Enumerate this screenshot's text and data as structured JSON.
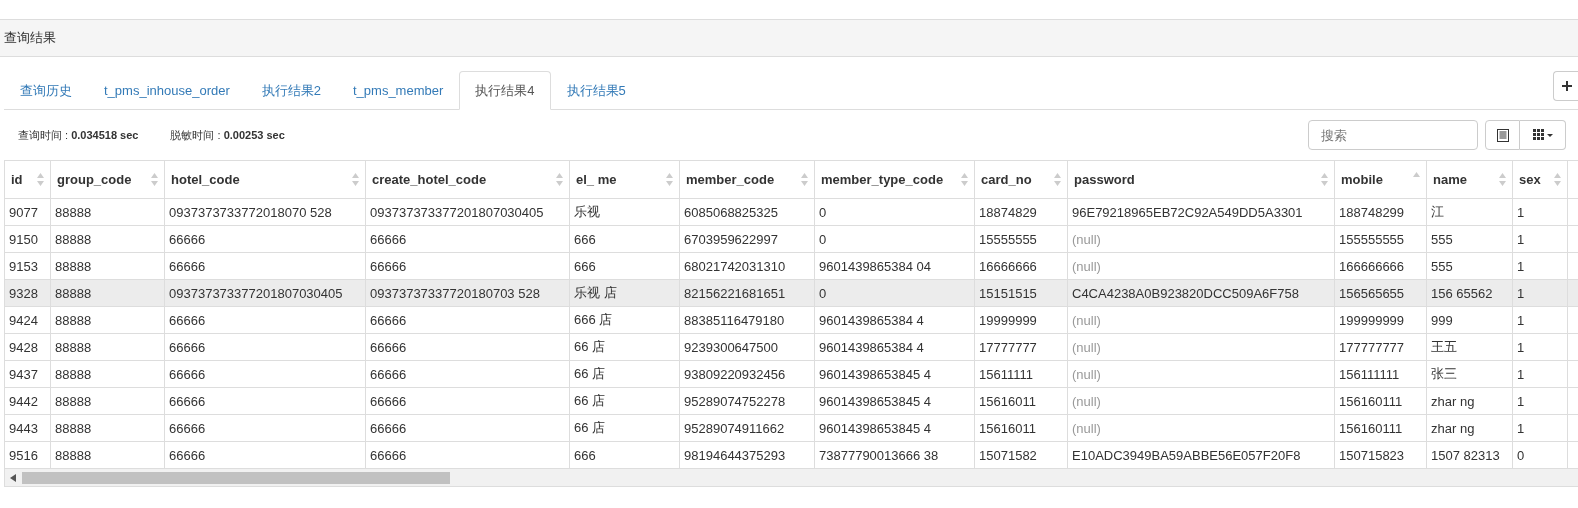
{
  "panel": {
    "title": "查询结果"
  },
  "tabs": [
    {
      "label": "查询历史",
      "selected": false
    },
    {
      "label": "t_pms_inhouse_order",
      "selected": false
    },
    {
      "label": "执行结果2",
      "selected": false
    },
    {
      "label": "t_pms_member",
      "selected": false
    },
    {
      "label": "执行结果4",
      "selected": true
    },
    {
      "label": "执行结果5",
      "selected": false
    }
  ],
  "stats": [
    {
      "label": "查询时间 : ",
      "value": "0.034518 sec"
    },
    {
      "label": "脱敏时间 : ",
      "value": "0.00253 sec"
    }
  ],
  "search": {
    "placeholder": "搜索"
  },
  "table": {
    "columns": [
      {
        "label": "id",
        "sort_up": true,
        "sort_down": true
      },
      {
        "label": "group_code",
        "sort_up": true,
        "sort_down": true
      },
      {
        "label": "hotel_code",
        "sort_up": true,
        "sort_down": true
      },
      {
        "label": "create_hotel_code",
        "sort_up": true,
        "sort_down": true
      },
      {
        "label": "el_ me",
        "sort_up": true,
        "sort_down": true
      },
      {
        "label": "member_code",
        "sort_up": true,
        "sort_down": true
      },
      {
        "label": "member_type_code",
        "sort_up": true,
        "sort_down": true
      },
      {
        "label": "card_no",
        "sort_up": true,
        "sort_down": true
      },
      {
        "label": "password",
        "sort_up": true,
        "sort_down": true
      },
      {
        "label": "mobile",
        "sort_up": true,
        "sort_down": false
      },
      {
        "label": "name",
        "sort_up": true,
        "sort_down": true
      },
      {
        "label": "sex",
        "sort_up": true,
        "sort_down": true
      }
    ],
    "rows": [
      {
        "highlighted": false,
        "cells": [
          "9077",
          "88888",
          "0937373733772018070 528",
          "093737373377201807030405",
          "乐视",
          "6085068825325",
          "0",
          "18874829",
          "96E79218965EB72C92A549DD5A3301",
          "188748299",
          "江",
          "1"
        ]
      },
      {
        "highlighted": false,
        "cells": [
          "9150",
          "88888",
          "66666",
          "66666",
          "666",
          "6703959622997",
          "0",
          "15555555",
          {
            "text": "(null)",
            "kind": "null"
          },
          "155555555",
          "555",
          "1"
        ]
      },
      {
        "highlighted": false,
        "cells": [
          "9153",
          "88888",
          "66666",
          "66666",
          "666",
          "68021742031310",
          "9601439865384 04",
          "16666666",
          {
            "text": "(null)",
            "kind": "null"
          },
          "166666666",
          "555",
          "1"
        ]
      },
      {
        "highlighted": true,
        "cells": [
          "9328",
          "88888",
          "093737373377201807030405",
          "09373737337720180703 528",
          "乐视 店",
          "82156221681651",
          "0",
          "15151515",
          "C4CA4238A0B923820DCC509A6F758",
          "156565655",
          "156 65562",
          "1"
        ]
      },
      {
        "highlighted": false,
        "cells": [
          "9424",
          "88888",
          "66666",
          "66666",
          "666 店",
          "88385116479180",
          "9601439865384 4",
          "19999999",
          {
            "text": "(null)",
            "kind": "null"
          },
          "199999999",
          "999",
          "1"
        ]
      },
      {
        "highlighted": false,
        "cells": [
          "9428",
          "88888",
          "66666",
          "66666",
          "66 店",
          "9239300647500",
          "9601439865384 4",
          "17777777",
          {
            "text": "(null)",
            "kind": "null"
          },
          "177777777",
          "王五",
          "1"
        ]
      },
      {
        "highlighted": false,
        "cells": [
          "9437",
          "88888",
          "66666",
          "66666",
          "66 店",
          "93809220932456",
          "96014398653845 4",
          "15611111",
          {
            "text": "(null)",
            "kind": "null"
          },
          "156111111",
          "张三",
          "1"
        ]
      },
      {
        "highlighted": false,
        "cells": [
          "9442",
          "88888",
          "66666",
          "66666",
          "66 店",
          "95289074752278",
          "96014398653845 4",
          "15616011",
          {
            "text": "(null)",
            "kind": "null"
          },
          "156160111",
          "zhar ng",
          "1"
        ]
      },
      {
        "highlighted": false,
        "cells": [
          "9443",
          "88888",
          "66666",
          "66666",
          "66 店",
          "95289074911662",
          "96014398653845 4",
          "15616011",
          {
            "text": "(null)",
            "kind": "null"
          },
          "156160111",
          "zhar ng",
          "1"
        ]
      },
      {
        "highlighted": false,
        "cells": [
          "9516",
          "88888",
          "66666",
          "66666",
          "666",
          "98194644375293",
          "73877790013666 38",
          "15071582",
          "E10ADC3949BA59ABBE56E057F20F8",
          "150715823",
          "1507 82313",
          "0"
        ]
      }
    ]
  }
}
